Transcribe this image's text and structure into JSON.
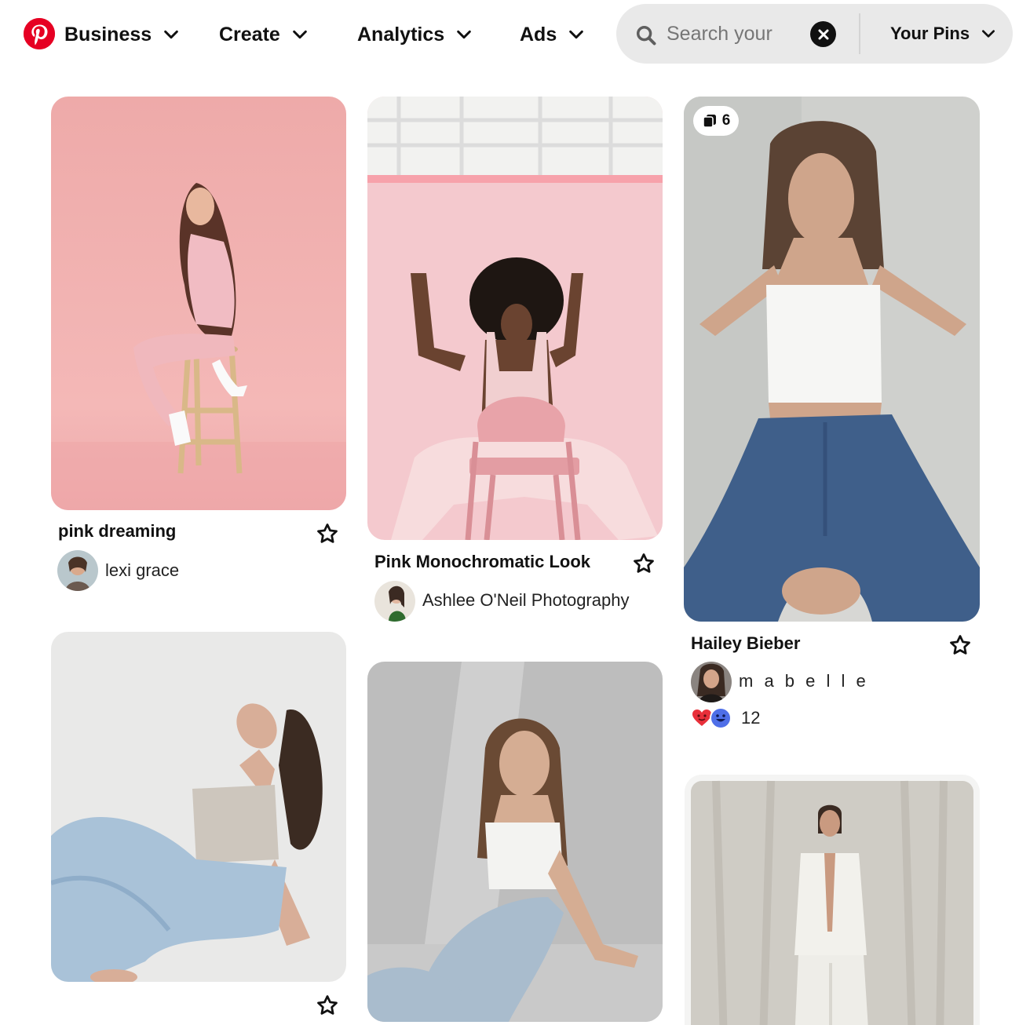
{
  "header": {
    "nav": [
      {
        "label": "Business"
      },
      {
        "label": "Create"
      },
      {
        "label": "Analytics"
      },
      {
        "label": "Ads"
      }
    ],
    "search": {
      "placeholder": "Search your Pins",
      "value": ""
    },
    "your_pins_label": "Your Pins"
  },
  "pins": [
    {
      "title": "pink dreaming",
      "author": "lexi grace",
      "photo": "woman in pink outfit on wooden stool, pink backdrop"
    },
    {
      "title": "Pink Monochromatic Look",
      "author": "Ashlee O'Neil Photography",
      "photo": "woman with curly hair seated on pink folding chair"
    },
    {
      "title": "Hailey Bieber",
      "author": "m a b e l l e",
      "image_count": "6",
      "reaction_count": "12",
      "reactions": [
        "heart",
        "smile"
      ],
      "photo": "woman in white crop top and blue jeans against grey wall"
    },
    {
      "title": "",
      "author": "",
      "photo": "woman in grey top and light jeans seated, head tilted back"
    },
    {
      "title": "",
      "author": "",
      "photo": "woman in white top and light jeans sitting on floor"
    },
    {
      "title": "",
      "author": "",
      "photo": "woman in white suit against draped backdrop"
    }
  ],
  "colors": {
    "brand": "#e60023",
    "search_bg": "#e9e9e9",
    "text": "#111111"
  },
  "icons": [
    "pinterest-logo-icon",
    "chevron-down-icon",
    "search-icon",
    "clear-icon",
    "star-outline-icon",
    "stack-icon"
  ]
}
